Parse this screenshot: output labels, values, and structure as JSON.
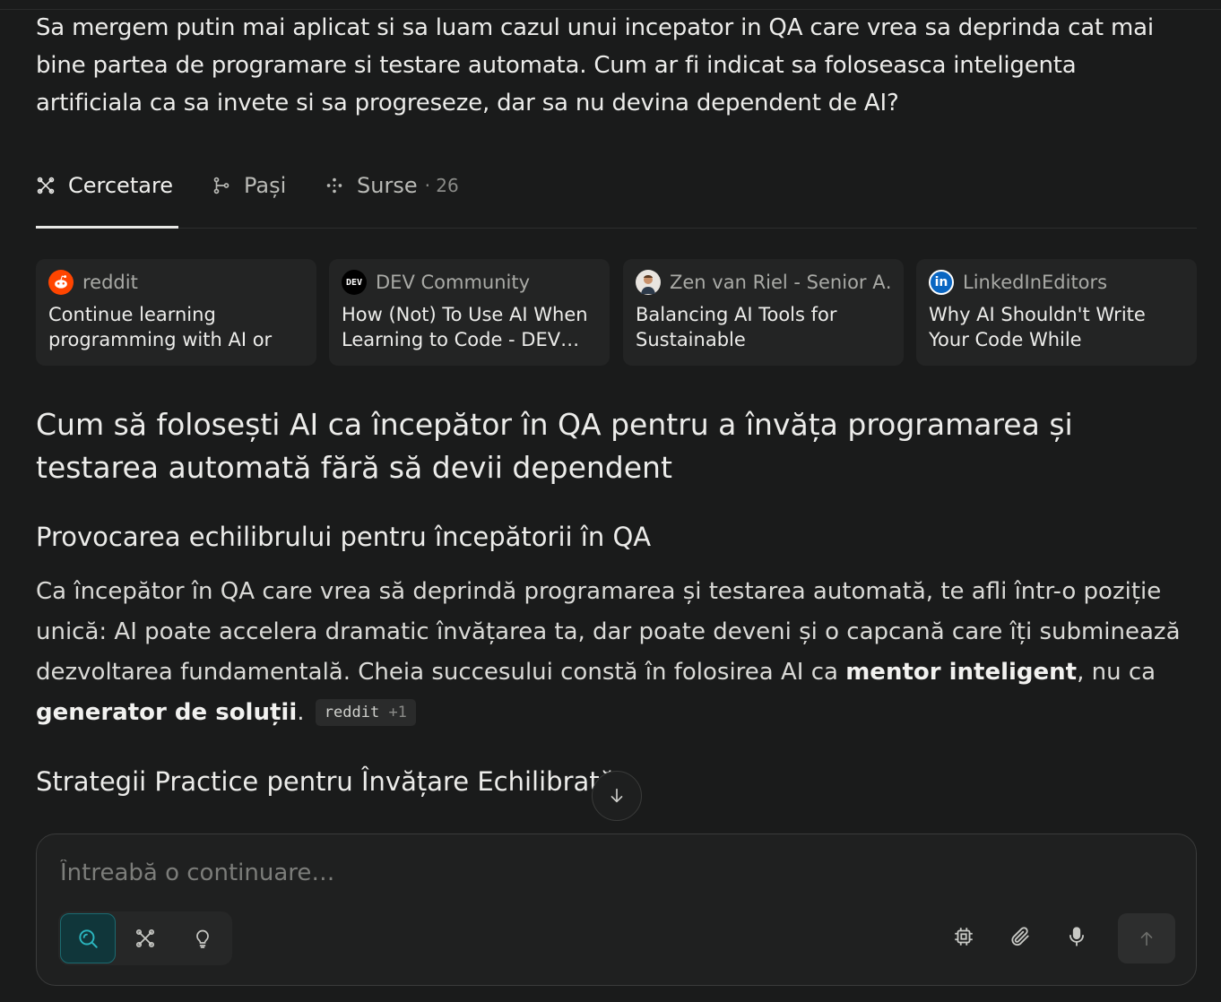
{
  "question": "Sa mergem putin mai aplicat si sa luam cazul unui incepator in QA care vrea sa deprinda cat mai bine partea de programare si testare automata. Cum ar fi indicat sa foloseasca inteligenta artificiala ca sa invete si sa progreseze, dar sa nu devina dependent de AI?",
  "tabs": [
    {
      "label": "Cercetare",
      "icon": "research-icon"
    },
    {
      "label": "Pași",
      "icon": "steps-icon"
    },
    {
      "label": "Surse",
      "icon": "sources-icon",
      "count": "· 26"
    }
  ],
  "sources": [
    {
      "site": "reddit",
      "title": "Continue learning programming with AI or no…",
      "icon": "reddit-icon"
    },
    {
      "site": "DEV Community",
      "title": "How (Not) To Use AI When Learning to Code - DEV…",
      "icon": "dev-icon"
    },
    {
      "site": "Zen van Riel - Senior A…",
      "title": "Balancing AI Tools for Sustainable Programming…",
      "icon": "avatar-icon"
    },
    {
      "site": "LinkedInEditors",
      "title": "Why AI Shouldn't Write Your Code While Learning,…",
      "icon": "linkedin-icon"
    }
  ],
  "answer": {
    "title": "Cum să folosești AI ca începător în QA pentru a învăța programarea și testarea automată fără să devii dependent",
    "section1_heading": "Provocarea echilibrului pentru începătorii în QA",
    "para_part1": "Ca începător în QA care vrea să deprindă programarea și testarea automată, te afli într-o poziție unică: AI poate accelera dramatic învățarea ta, dar poate deveni și o capcană care îți subminează dezvoltarea fundamentală. Cheia succesului constă în folosirea AI ca ",
    "bold1": "mentor inteligent",
    "para_part2": ", nu ca ",
    "bold2": "generator de soluții",
    "para_part3": ".",
    "citation_source": "reddit",
    "citation_more": "+1",
    "section2_heading": "Strategii Practice pentru Învățare Echilibrată"
  },
  "composer": {
    "placeholder": "Întreabă o continuare…",
    "modes": [
      "search-icon",
      "research-icon",
      "lightbulb-icon"
    ],
    "actions": [
      "chip-icon",
      "paperclip-icon",
      "microphone-icon"
    ],
    "send_icon": "arrow-up-icon"
  },
  "colors": {
    "background": "#1a1b1b",
    "accent": "#1b6a70"
  }
}
